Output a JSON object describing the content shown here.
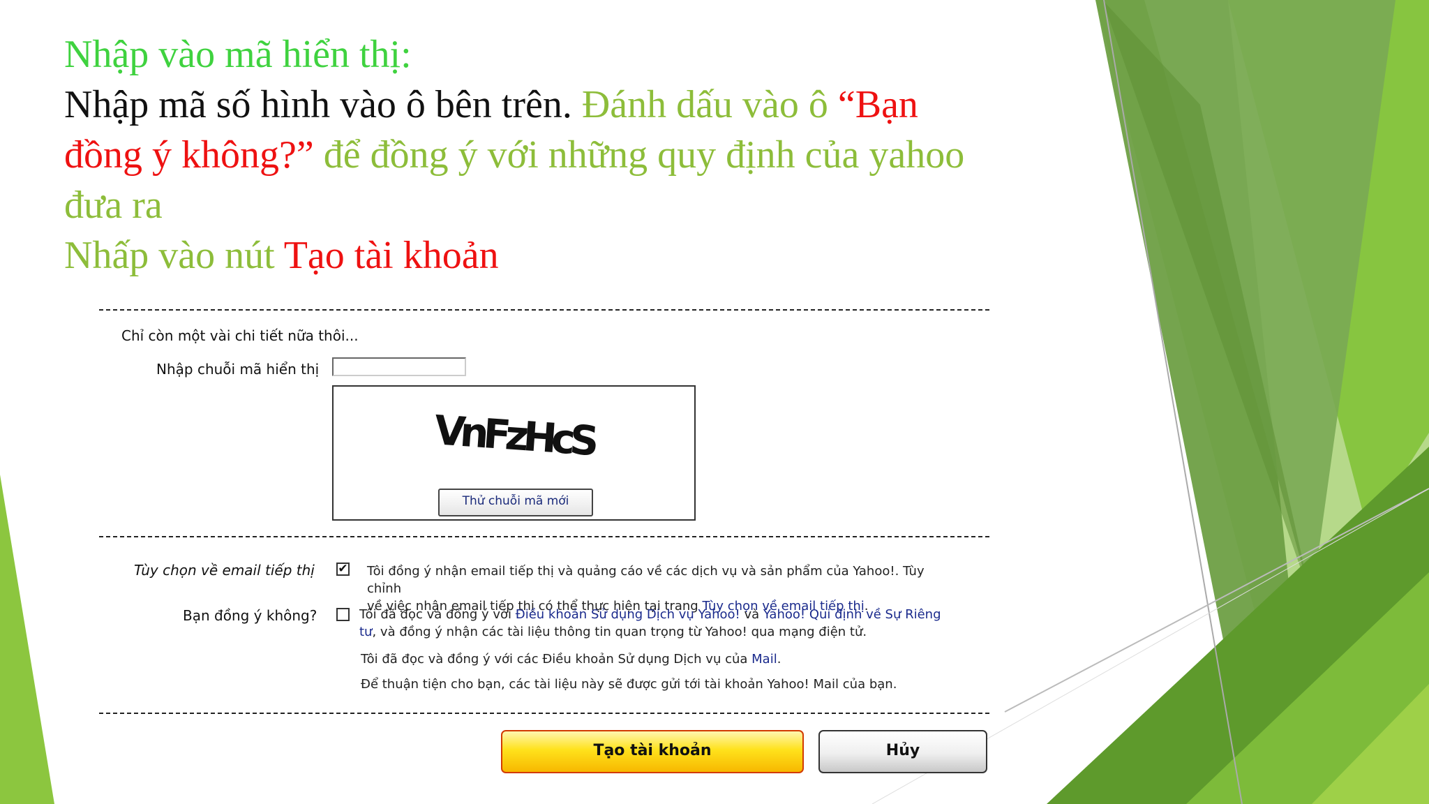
{
  "slide": {
    "heading": "Nhập vào mã hiển thị:",
    "line2_black": "Nhập mã số hình vào ô bên trên. ",
    "line2_olive": "Đánh dấu vào ô ",
    "line2_red": "“Bạn",
    "line3_red": "đồng ý không?”",
    "line3_olive": " để đồng ý với những quy định của yahoo",
    "line4_olive": "đưa ra",
    "line5_olive": "Nhấp vào nút ",
    "line5_red": "Tạo tài khoản"
  },
  "form": {
    "intro": "Chỉ còn một vài chi tiết nữa thôi...",
    "captcha_label": "Nhập chuỗi mã hiển thị",
    "captcha_input_value": "",
    "captcha_text": "VnFzHcS",
    "new_captcha_label": "Thử chuỗi mã mới",
    "marketing": {
      "label": "Tùy chọn về email tiếp thị",
      "checked": true,
      "text1": "Tôi đồng ý nhận email tiếp thị và quảng cáo về các dịch vụ và sản phẩm của Yahoo!. Tùy chỉnh",
      "text2": "về việc nhận email tiếp thị có thể thực hiện tại trang ",
      "link": "Tùy chọn về email tiếp thị",
      "text2_end": "."
    },
    "agree": {
      "label": "Bạn đồng ý không?",
      "checked": false,
      "text1": "Tôi đã đọc và đồng ý với ",
      "link1": "Điều khoản Sử dụng Dịch vụ Yahoo!",
      "text_and": " và ",
      "link2a": "Yahoo! Qui định về Sự Riêng",
      "link2b": "tư",
      "text2": ", và đồng ý nhận các tài liệu thông tin quan trọng từ Yahoo! qua mạng điện tử.",
      "mail_text": "Tôi đã đọc và đồng ý với các Điều khoản Sử dụng Dịch vụ của ",
      "mail_link": "Mail",
      "mail_end": ".",
      "note": "Để thuận tiện cho bạn, các tài liệu này sẽ được gửi tới tài khoản Yahoo! Mail của bạn."
    },
    "create_button": "Tạo tài khoản",
    "cancel_button": "Hủy"
  },
  "colors": {
    "heading_green": "#3fd23f",
    "olive_green": "#8dbd3a",
    "red": "#ee1111",
    "decor_green_dark": "#5e8f2f",
    "decor_green_light": "#9acd32"
  }
}
